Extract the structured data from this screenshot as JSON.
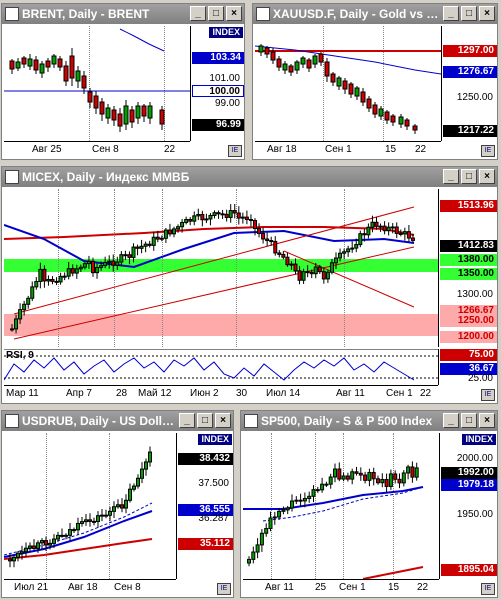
{
  "colors": {
    "up": "#00a000",
    "down": "#cc0000",
    "ma_red": "#cc0000",
    "ma_blue": "#0000cc",
    "green_zone": "#33ff33",
    "pink_zone": "#ffaaaa"
  },
  "windows": {
    "brent": {
      "title": "BRENT, Daily - BRENT",
      "index_label": "INDEX",
      "levels": [
        "103.34",
        "101.00",
        "100.00",
        "99.00",
        "96.99"
      ],
      "x_labels": [
        "Авг 25",
        "Сен 8",
        "22"
      ]
    },
    "gold": {
      "title": "XAUUSD.F, Daily - Gold vs US...",
      "levels": [
        "1297.00",
        "1276.67",
        "1250.00",
        "1217.22"
      ],
      "x_labels": [
        "Авг 18",
        "Сен 1",
        "15",
        "22"
      ]
    },
    "micex": {
      "title": "MICEX, Daily - Индекс ММВБ",
      "levels": [
        "1513.96",
        "1412.83",
        "1380.00",
        "1350.00",
        "1300.00",
        "1266.67",
        "1250.00",
        "1200.00"
      ],
      "x_labels": [
        "Мар 11",
        "Апр 7",
        "28",
        "Май 12",
        "Июн 2",
        "30",
        "Июл 14",
        "Авг 11",
        "Сен 1",
        "22"
      ],
      "rsi_label": "RSI, 9",
      "rsi_levels": [
        "75.00",
        "36.67",
        "25.00"
      ]
    },
    "usdrub": {
      "title": "USDRUB, Daily - US Dollar...",
      "index_label": "INDEX",
      "levels": [
        "38.432",
        "37.500",
        "36.555",
        "36.287",
        "35.112"
      ],
      "x_labels": [
        "Июл 21",
        "Авг 18",
        "Сен 8"
      ]
    },
    "sp500": {
      "title": "SP500, Daily - S & P 500 Index",
      "index_label": "INDEX",
      "levels": [
        "2000.00",
        "1992.00",
        "1979.18",
        "1950.00",
        "1895.04"
      ],
      "x_labels": [
        "Авг 11",
        "25",
        "Сен 1",
        "15",
        "22"
      ]
    }
  },
  "buttons": {
    "minimize": "_",
    "maximize": "□",
    "close": "×"
  }
}
